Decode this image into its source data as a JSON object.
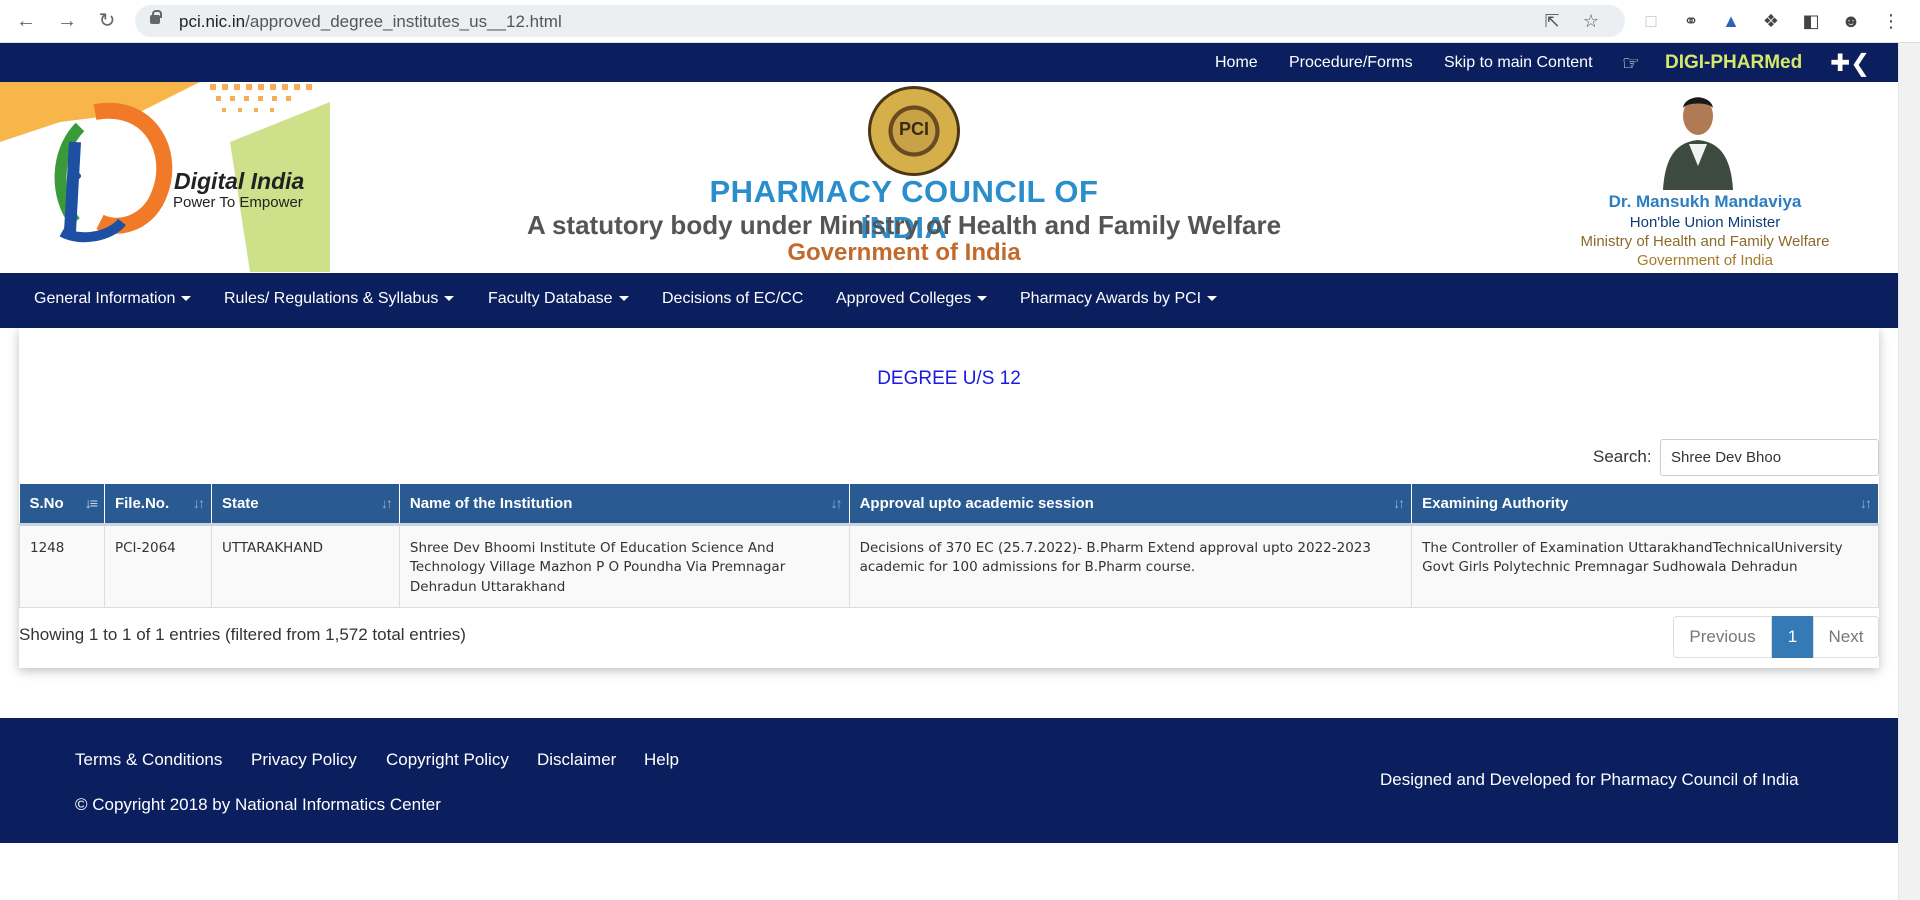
{
  "browser": {
    "url_domain": "pci.nic.in",
    "url_path": "/approved_degree_institutes_us__12.html"
  },
  "topbar": {
    "links": [
      "Home",
      "Procedure/Forms",
      "Skip to main Content"
    ],
    "brand": "DIGI-PHARMed"
  },
  "header": {
    "digital_india_title": "Digital India",
    "digital_india_tagline": "Power To Empower",
    "council_name": "PHARMACY COUNCIL OF INDIA",
    "council_subtitle": "A statutory body under Ministry of Health and Family Welfare",
    "council_government": "Government of India",
    "minister_name": "Dr. Mansukh Mandaviya",
    "minister_line1": "Hon'ble Union Minister",
    "minister_line2": "Ministry of Health and Family Welfare",
    "minister_line3": "Government of India"
  },
  "mainnav": {
    "items": [
      {
        "label": "General Information",
        "dropdown": true
      },
      {
        "label": "Rules/ Regulations & Syllabus",
        "dropdown": true
      },
      {
        "label": "Faculty Database",
        "dropdown": true
      },
      {
        "label": "Decisions of EC/CC",
        "dropdown": false
      },
      {
        "label": "Approved Colleges",
        "dropdown": true
      },
      {
        "label": "Pharmacy Awards by PCI",
        "dropdown": true
      }
    ]
  },
  "content": {
    "heading": "DEGREE U/S 12",
    "search_label": "Search:",
    "search_value": "Shree Dev Bhoo",
    "columns": [
      "S.No",
      "File.No.",
      "State",
      "Name of the Institution",
      "Approval upto academic session",
      "Examining Authority"
    ],
    "rows": [
      {
        "sno": "1248",
        "file_no": "PCI-2064",
        "state": "UTTARAKHAND",
        "institution": "Shree Dev Bhoomi Institute Of Education Science And Technology Village Mazhon P O Poundha Via Premnagar Dehradun Uttarakhand",
        "approval": "Decisions of 370 EC (25.7.2022)- B.Pharm Extend approval upto 2022-2023 academic for 100 admissions for B.Pharm course.",
        "authority": "The Controller of Examination UttarakhandTechnicalUniversity Govt Girls Polytechnic  Premnagar Sudhowala Dehradun"
      }
    ],
    "info": "Showing 1 to 1 of 1 entries (filtered from 1,572 total entries)",
    "pager": {
      "previous": "Previous",
      "current": "1",
      "next": "Next"
    }
  },
  "footer": {
    "links": [
      "Terms & Conditions",
      "Privacy Policy",
      "Copyright Policy",
      "Disclaimer",
      "Help"
    ],
    "copyright": "© Copyright 2018 by National Informatics Center",
    "designed": "Designed and Developed for Pharmacy Council of India"
  },
  "colors": {
    "navy": "#0b1f5e",
    "table_header": "#2a5a92",
    "heading_blue": "#1a1ae0",
    "pager_active": "#337ab7",
    "digi_brand": "#d5e86c"
  }
}
